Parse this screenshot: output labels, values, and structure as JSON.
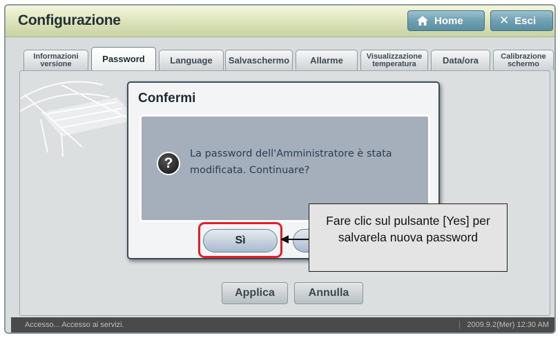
{
  "window": {
    "title": "Configurazione",
    "home_label": "Home",
    "exit_label": "Esci"
  },
  "tabs": [
    {
      "label": "Informazioni versione",
      "active": false
    },
    {
      "label": "Password",
      "active": true
    },
    {
      "label": "Language",
      "active": false
    },
    {
      "label": "Salvaschermo",
      "active": false
    },
    {
      "label": "Allarme",
      "active": false
    },
    {
      "label": "Visualizzazione temperatura",
      "active": false
    },
    {
      "label": "Data/ora",
      "active": false
    },
    {
      "label": "Calibrazione schermo",
      "active": false
    }
  ],
  "content": {
    "apply_label": "Applica",
    "cancel_label": "Annulla"
  },
  "dialog": {
    "title": "Confermi",
    "message": "La password dell'Amministratore è stata modificata. Continuare?",
    "yes_label": "Sì",
    "icon": "question-icon"
  },
  "callout": {
    "text": "Fare clic sul pulsante [Yes] per salvarela nuova password"
  },
  "status": {
    "left": "Accesso... Accesso ai servizi.",
    "right": "2009.9.2(Mer) 12:30 AM"
  },
  "colors": {
    "titlebar": "#dbe2b8",
    "button_accent": "#6fa0b2",
    "highlight": "#e51e25",
    "dialog_body": "#a4afbb"
  }
}
